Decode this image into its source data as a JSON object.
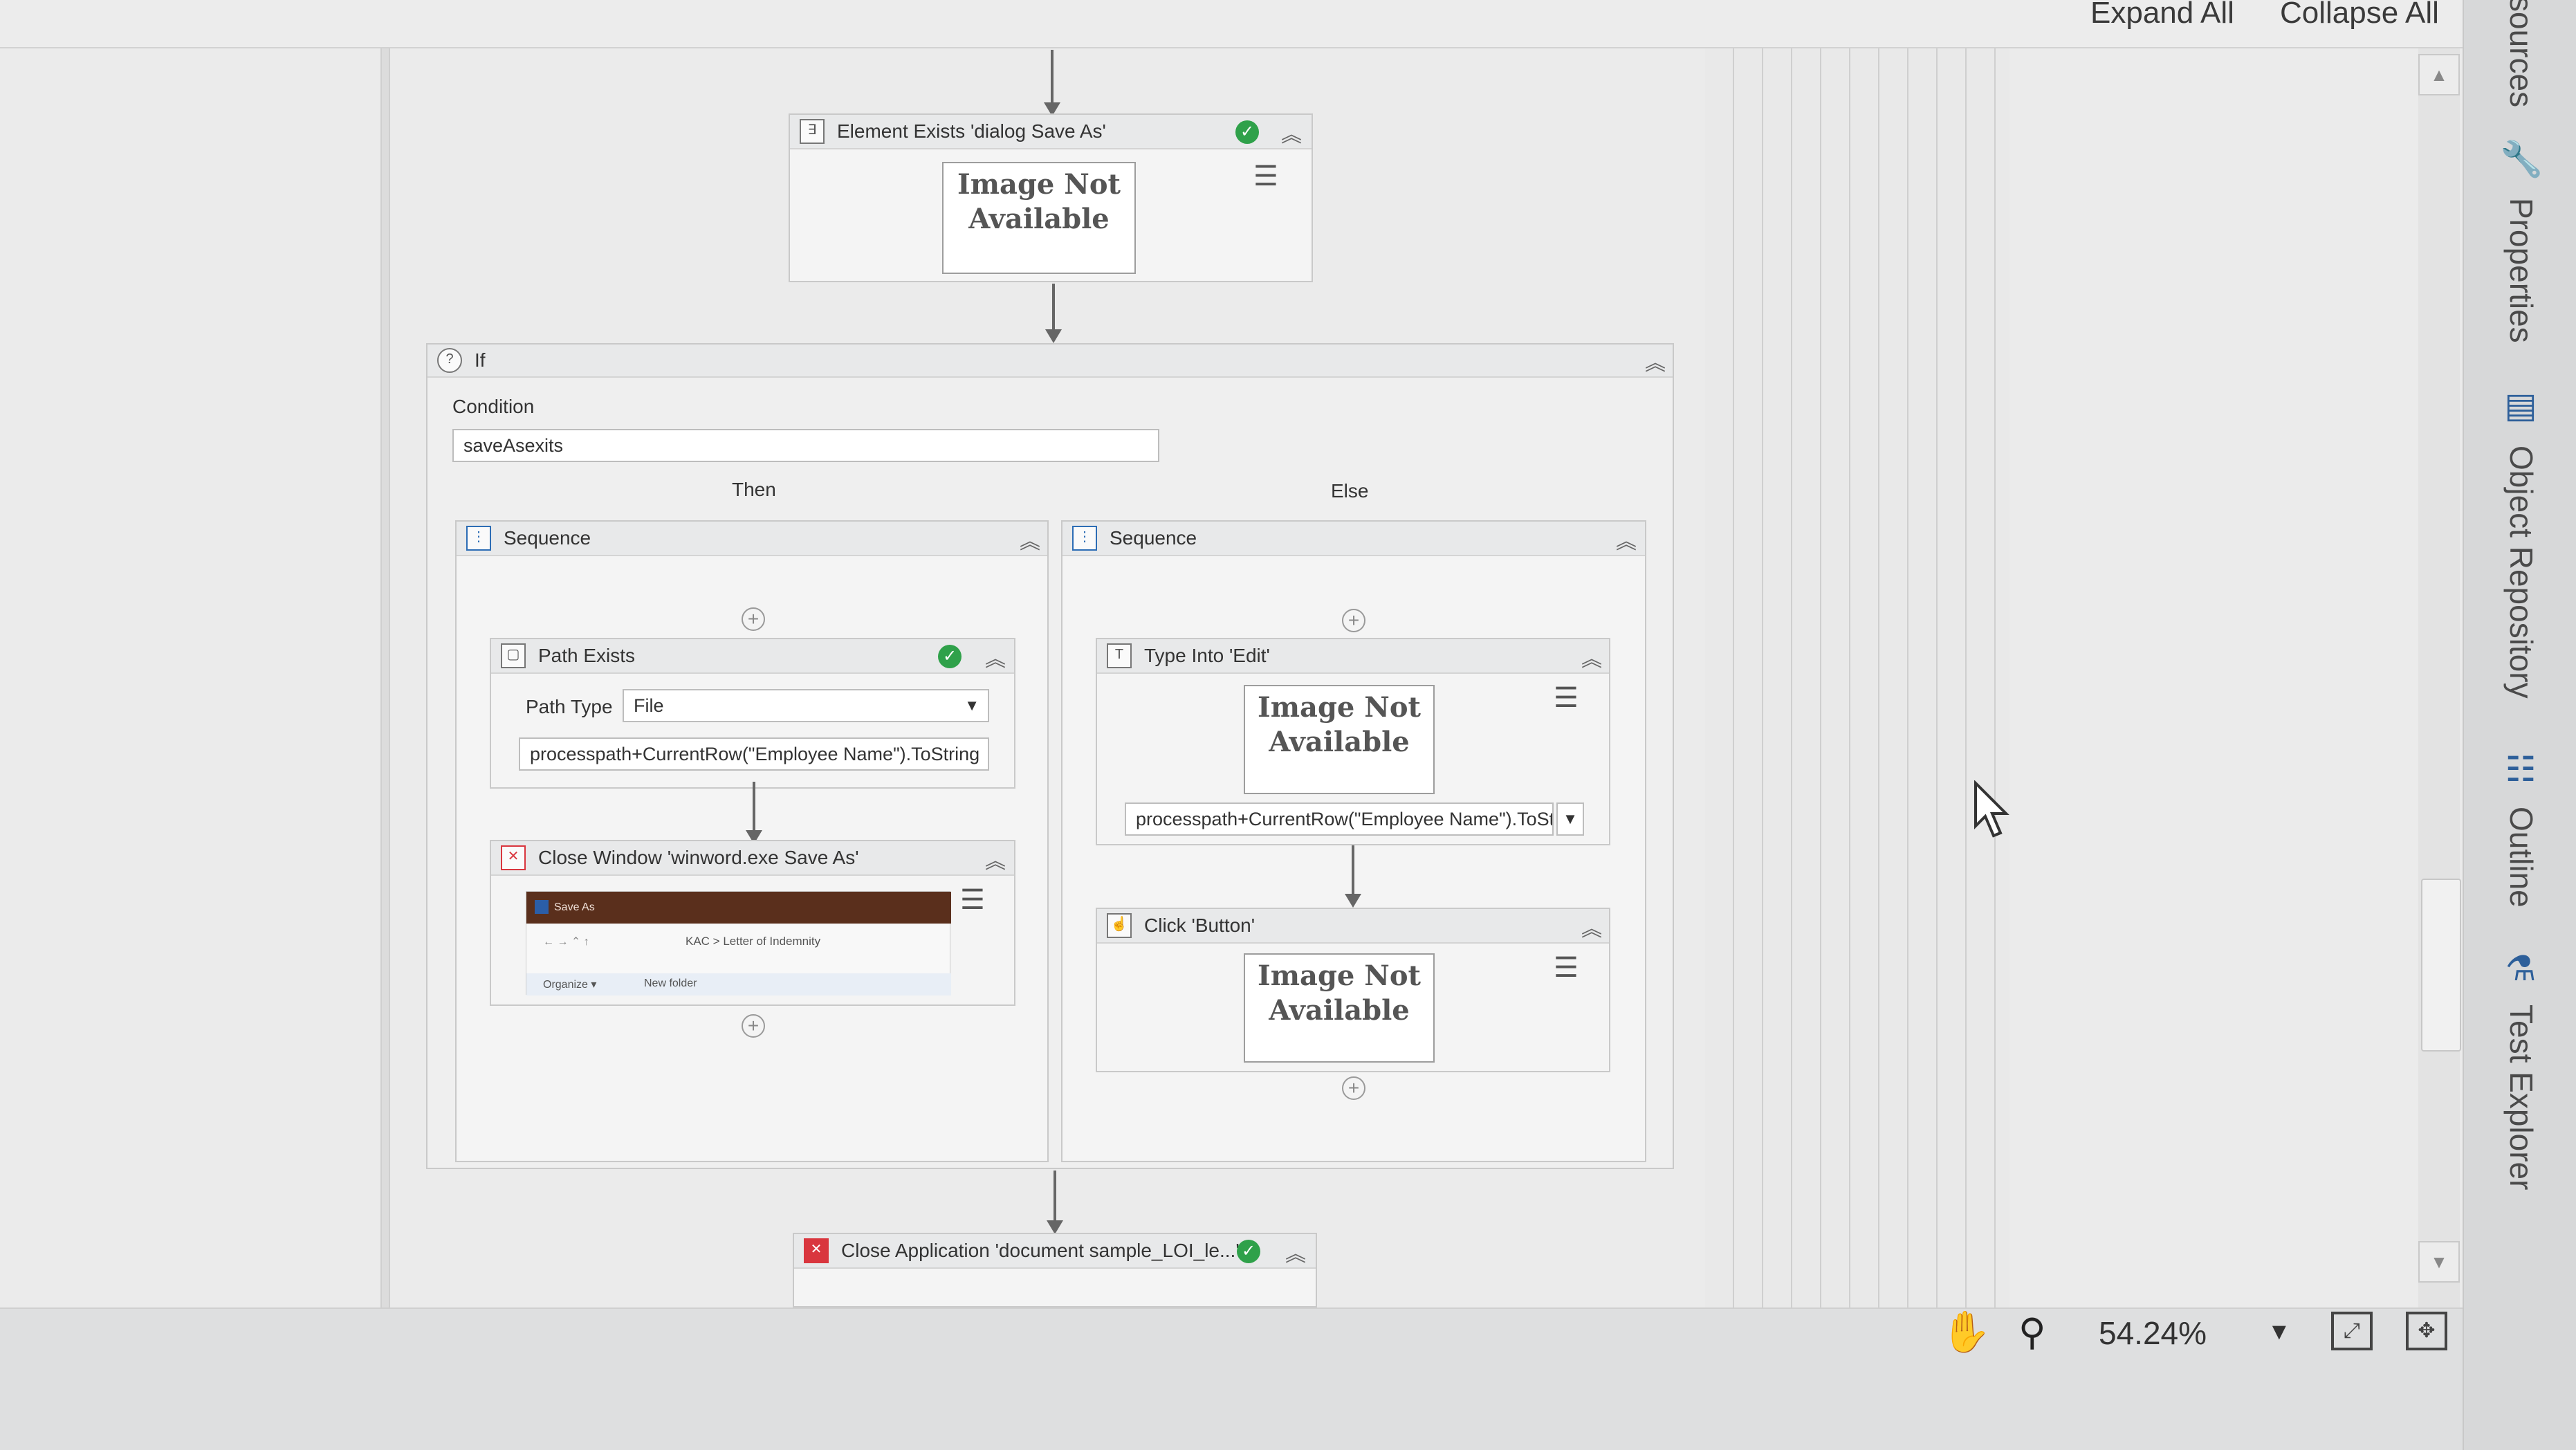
{
  "toolbar": {
    "expand_all": "Expand All",
    "collapse_all": "Collapse All"
  },
  "side_panel": {
    "tabs": [
      {
        "label": "sources"
      },
      {
        "label": "Properties",
        "icon": "wrench-icon"
      },
      {
        "label": "Object Repository",
        "icon": "object-repository-icon"
      },
      {
        "label": "Outline",
        "icon": "outline-icon"
      },
      {
        "label": "Test Explorer",
        "icon": "test-explorer-icon"
      }
    ]
  },
  "workflow": {
    "element_exists": {
      "title": "Element Exists 'dialog  Save As'",
      "image_text": "Image Not Available"
    },
    "if": {
      "title": "If",
      "condition_label": "Condition",
      "condition_value": "saveAsexits",
      "then_label": "Then",
      "else_label": "Else"
    },
    "then_sequence": {
      "title": "Sequence",
      "path_exists": {
        "title": "Path Exists",
        "path_type_label": "Path Type",
        "path_type_value": "File",
        "path_value": "processpath+CurrentRow(\"Employee Name\").ToString"
      },
      "close_window": {
        "title": "Close Window 'winword.exe  Save As'",
        "preview_title": "Save As",
        "preview_breadcrumb": "KAC  >  Letter of Indemnity",
        "preview_organize": "Organize ▾",
        "preview_new_folder": "New folder"
      }
    },
    "else_sequence": {
      "title": "Sequence",
      "type_into": {
        "title": "Type Into 'Edit'",
        "image_text": "Image Not Available",
        "text_value": "processpath+CurrentRow(\"Employee Name\").ToStri"
      },
      "click_button": {
        "title": "Click 'Button'",
        "image_text": "Image Not Available"
      }
    },
    "close_application": {
      "title": "Close Application 'document  sample_LOI_le...'"
    }
  },
  "status_bar": {
    "zoom": "54.24%"
  },
  "colors": {
    "success": "#2fa14a",
    "error": "#d9363e",
    "sequence_icon": "#2d6db5"
  }
}
